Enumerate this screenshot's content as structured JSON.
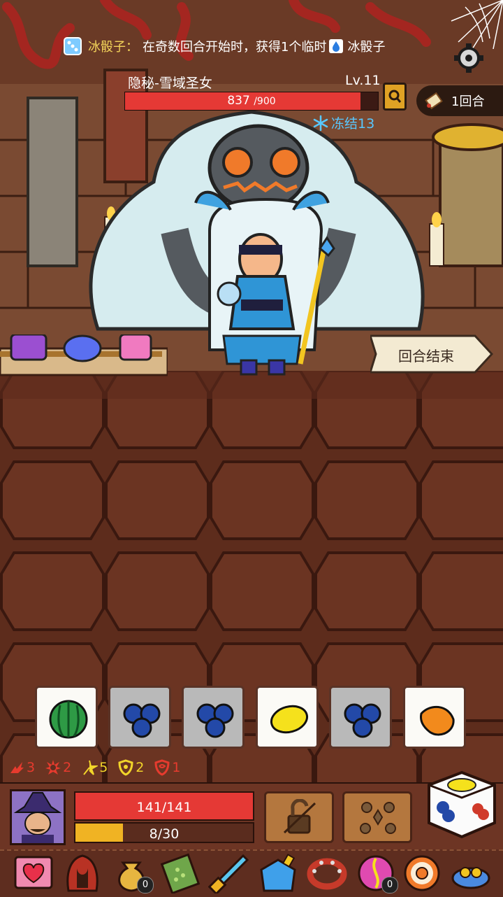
{
  "notice": {
    "dice_name": "冰骰子：",
    "text": "在奇数回合开始时，获得1个临时",
    "tail": "冰骰子"
  },
  "enemy": {
    "name": "隐秘-雪域圣女",
    "level": "Lv.11",
    "hp_current": "837",
    "hp_max": "/900",
    "hp_fraction": 0.93,
    "freeze_label": "冻结13"
  },
  "round": {
    "label": "1回合"
  },
  "end_turn": {
    "label": "回合结束"
  },
  "dice": [
    {
      "face": "watermelon",
      "state": "white"
    },
    {
      "face": "blueberry",
      "state": "gray"
    },
    {
      "face": "blueberry",
      "state": "gray"
    },
    {
      "face": "lemon",
      "state": "white"
    },
    {
      "face": "blueberry",
      "state": "gray"
    },
    {
      "face": "orange",
      "state": "white"
    }
  ],
  "status_effects": [
    {
      "icon": "rage-icon",
      "value": "3"
    },
    {
      "icon": "burst-icon",
      "value": "2"
    },
    {
      "icon": "spark-icon",
      "value": "5"
    },
    {
      "icon": "shield-icon",
      "value": "2"
    },
    {
      "icon": "armor-icon",
      "value": "1"
    }
  ],
  "player": {
    "hp": "141/141",
    "xp": "8/30",
    "xp_fraction": 0.267
  },
  "inventory": [
    {
      "icon": "heart-card-icon"
    },
    {
      "icon": "hood-icon"
    },
    {
      "icon": "money-bag-icon",
      "count": "0"
    },
    {
      "icon": "green-scroll-icon"
    },
    {
      "icon": "crystal-sword-icon"
    },
    {
      "icon": "blue-potion-icon"
    },
    {
      "icon": "spiked-collar-icon"
    },
    {
      "icon": "magic-orb-icon",
      "count": "0"
    },
    {
      "icon": "donut-icon"
    },
    {
      "icon": "gem-cap-icon"
    }
  ],
  "colors": {
    "hp_red": "#e53935",
    "xp_gold": "#f0b323",
    "freeze_blue": "#58c8ff",
    "status_red": "#e63b2e",
    "status_yellow": "#f2d52a"
  }
}
